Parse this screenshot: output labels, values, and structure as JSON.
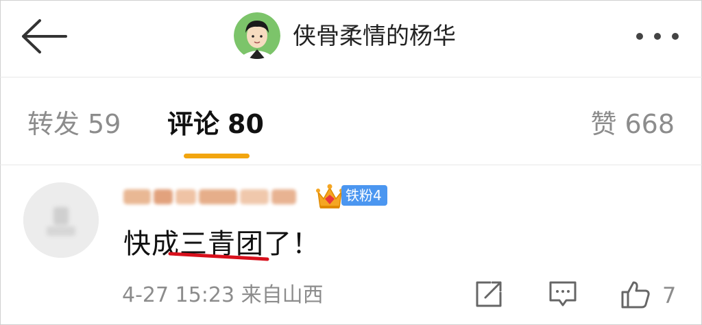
{
  "header": {
    "title": "侠骨柔情的杨华",
    "back_icon": "arrow-left-icon",
    "more_icon": "more-horizontal-icon"
  },
  "tabs": {
    "repost": {
      "label": "转发",
      "count": "59"
    },
    "comment": {
      "label": "评论",
      "count": "80",
      "active": true
    },
    "like": {
      "label": "赞",
      "count": "668"
    }
  },
  "accent_color": "#f2a50f",
  "comment": {
    "author": "",
    "badge": {
      "icon": "crown-icon",
      "label": "铁粉4",
      "color": "#4b96f0"
    },
    "text": "快成三青团了！",
    "highlight_color": "#d8101c",
    "time": "4-27 15:23",
    "source": "来自山西",
    "actions": {
      "share_icon": "share-icon",
      "reply_icon": "comment-icon",
      "like_icon": "thumb-up-icon",
      "like_count": "7"
    }
  }
}
